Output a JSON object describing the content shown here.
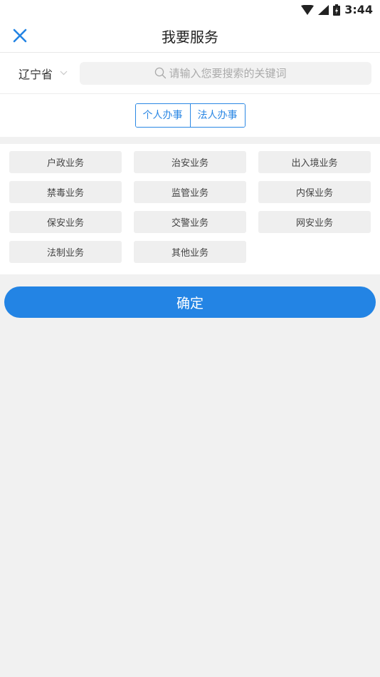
{
  "status": {
    "time": "3:44"
  },
  "header": {
    "title": "我要服务"
  },
  "search": {
    "province": "辽宁省",
    "placeholder": "请输入您要搜索的关键词"
  },
  "tabs": [
    {
      "label": "个人办事"
    },
    {
      "label": "法人办事"
    }
  ],
  "services": [
    {
      "label": "户政业务"
    },
    {
      "label": "治安业务"
    },
    {
      "label": "出入境业务"
    },
    {
      "label": "禁毒业务"
    },
    {
      "label": "监管业务"
    },
    {
      "label": "内保业务"
    },
    {
      "label": "保安业务"
    },
    {
      "label": "交警业务"
    },
    {
      "label": "网安业务"
    },
    {
      "label": "法制业务"
    },
    {
      "label": "其他业务"
    }
  ],
  "confirm": {
    "label": "确定"
  },
  "colors": {
    "accent": "#2384e4",
    "chip_bg": "#efefef",
    "page_bg": "#f1f1f1"
  }
}
